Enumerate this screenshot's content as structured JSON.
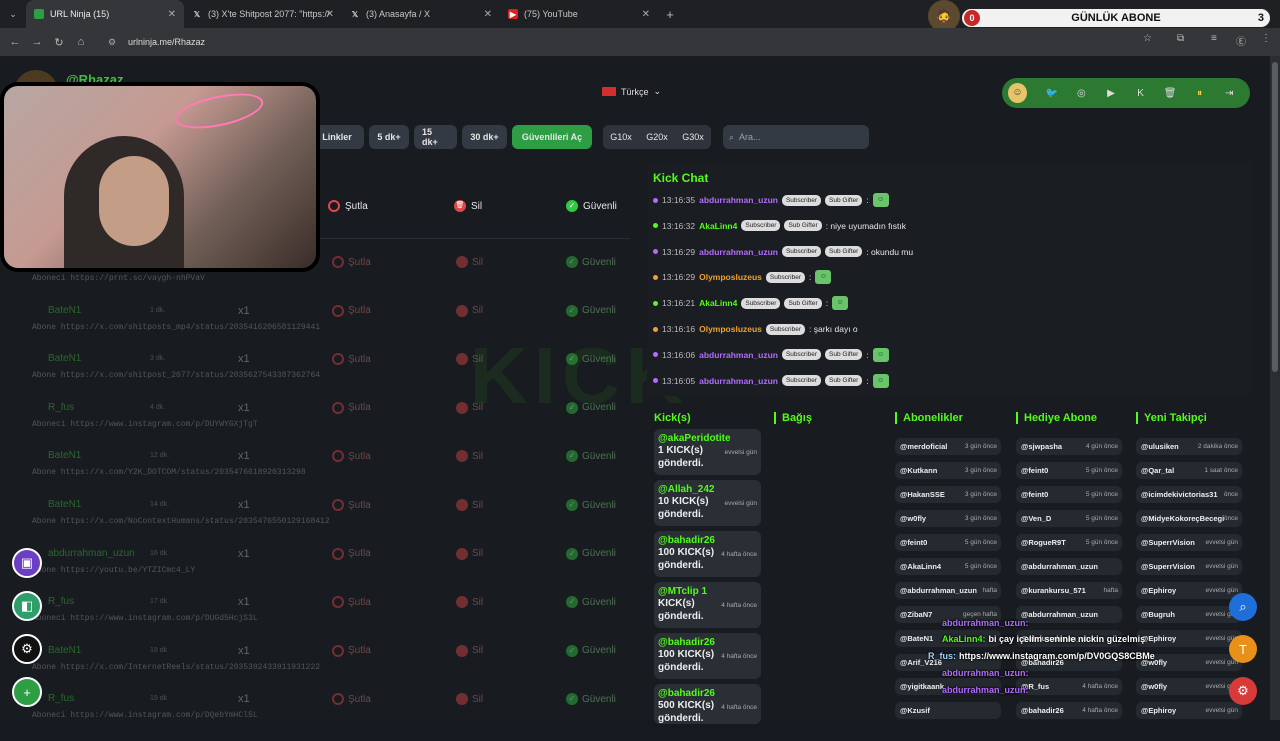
{
  "browser": {
    "tabs": [
      {
        "title": "URL Ninja (15)",
        "active": true,
        "icon": "urlninja-icon"
      },
      {
        "title": "(3) X'te Shitpost 2077: \"https://",
        "active": false,
        "icon": "x-icon"
      },
      {
        "title": "(3) Anasayfa / X",
        "active": false,
        "icon": "x-icon"
      },
      {
        "title": "(75) YouTube",
        "active": false,
        "icon": "youtube-icon"
      }
    ],
    "url": "urlninja.me/Rhazaz"
  },
  "sub_overlay": {
    "title": "GÜNLÜK ABONE",
    "left": "0",
    "right": "3"
  },
  "header": {
    "username": "@Rhazaz",
    "language": "Türkçe"
  },
  "filters": {
    "buttons": [
      "Linkler",
      "5 dk+",
      "15 dk+",
      "30 dk+",
      "Güvenlileri Aç",
      "G10x",
      "G20x",
      "G30x"
    ],
    "search_placeholder": "Ara..."
  },
  "actions_header": {
    "ban": "Şutla",
    "delete": "Sil",
    "safe": "Güvenli"
  },
  "links": [
    {
      "user": "",
      "time": "",
      "count": "",
      "link": "Aboneci https://prnt.sc/vaygh-nhPVaV"
    },
    {
      "user": "BateN1",
      "time": "1 dk.",
      "count": "x1",
      "link": "Abone https://x.com/shitposts_mp4/status/2035416206581129441"
    },
    {
      "user": "BateN1",
      "time": "3 dk.",
      "count": "x1",
      "link": "Abone https://x.com/shitpost_2077/status/2035627543387362764"
    },
    {
      "user": "R_fus",
      "time": "4 dk.",
      "count": "x1",
      "link": "Aboneci https://www.instagram.com/p/DUYWYGXjTgT"
    },
    {
      "user": "BateN1",
      "time": "12 dk.",
      "count": "x1",
      "link": "Abone https://x.com/Y2K_DOTCOM/status/2035476618920313298"
    },
    {
      "user": "BateN1",
      "time": "14 dk.",
      "count": "x1",
      "link": "Abone https://x.com/NoContextHumans/status/2035476550129168412"
    },
    {
      "user": "abdurrahman_uzun",
      "time": "16 dk.",
      "count": "x1",
      "link": "Abone https://youtu.be/YTZICmc4_LY"
    },
    {
      "user": "R_fus",
      "time": "17 dk.",
      "count": "x1",
      "link": "Aboneci https://www.instagram.com/p/DUGd5HcjS3L"
    },
    {
      "user": "BateN1",
      "time": "18 dk.",
      "count": "x1",
      "link": "Abone https://x.com/InternetReels/status/2035392433911931222"
    },
    {
      "user": "R_fus",
      "time": "19 dk.",
      "count": "x1",
      "link": "Aboneci https://www.instagram.com/p/DQebYmHCl5L"
    }
  ],
  "kick_chat": {
    "title": "Kick Chat",
    "messages": [
      {
        "time": "13:16:35",
        "user": "abdurrahman_uzun",
        "color": "#b36cff",
        "badges": [
          "Subscriber",
          "Sub Gifter"
        ],
        "text": ":"
      },
      {
        "time": "13:16:32",
        "user": "AkaLinn4",
        "color": "#53fc18",
        "badges": [
          "Subscriber",
          "Sub Gifter"
        ],
        "text": ": niye uyumadın fıstık"
      },
      {
        "time": "13:16:29",
        "user": "abdurrahman_uzun",
        "color": "#b36cff",
        "badges": [
          "Subscriber",
          "Sub Gifter"
        ],
        "text": ": okundu mu"
      },
      {
        "time": "13:16:29",
        "user": "Olymposluzeus",
        "color": "#f0a030",
        "badges": [
          "Subscriber"
        ],
        "text": ":"
      },
      {
        "time": "13:16:21",
        "user": "AkaLinn4",
        "color": "#53fc18",
        "badges": [
          "Subscriber",
          "Sub Gifter"
        ],
        "text": ":"
      },
      {
        "time": "13:16:16",
        "user": "Olymposluzeus",
        "color": "#f0a030",
        "badges": [
          "Subscriber"
        ],
        "text": ": şarkı dayı o"
      },
      {
        "time": "13:16:06",
        "user": "abdurrahman_uzun",
        "color": "#b36cff",
        "badges": [
          "Subscriber",
          "Sub Gifter"
        ],
        "text": ":"
      },
      {
        "time": "13:16:05",
        "user": "abdurrahman_uzun",
        "color": "#b36cff",
        "badges": [
          "Subscriber",
          "Sub Gifter"
        ],
        "text": ":"
      }
    ]
  },
  "columns": {
    "kicks": "Kick(s)",
    "donations": "Bağış",
    "subs": "Abonelikler",
    "gift_subs": "Hediye Abone",
    "followers": "Yeni Takipçi"
  },
  "kicks": [
    {
      "user": "@akaPeridotite",
      "text": "1 KICK(s) gönderdi.",
      "when": "evvelsi gün"
    },
    {
      "user": "@Allah_242",
      "text": "10 KICK(s) gönderdi.",
      "when": "evvelsi gün"
    },
    {
      "user": "@bahadir26",
      "text": "100 KICK(s) gönderdi.",
      "when": "4 hafta önce"
    },
    {
      "user": "@MTclip 1",
      "text": "KICK(s) gönderdi.",
      "when": "4 hafta önce"
    },
    {
      "user": "@bahadir26",
      "text": "100 KICK(s) gönderdi.",
      "when": "4 hafta önce"
    },
    {
      "user": "@bahadir26",
      "text": "500 KICK(s) gönderdi.",
      "when": "4 hafta önce"
    }
  ],
  "subs": [
    {
      "user": "@merdoficial",
      "when": "3 gün önce"
    },
    {
      "user": "@Kutkann",
      "when": "3 gün önce"
    },
    {
      "user": "@HakanSSE",
      "when": "3 gün önce"
    },
    {
      "user": "@w0fly",
      "when": "3 gün önce"
    },
    {
      "user": "@feint0",
      "when": "5 gün önce"
    },
    {
      "user": "@AkaLinn4",
      "when": "5 gün önce"
    },
    {
      "user": "@abdurrahman_uzun",
      "when": "hafta"
    },
    {
      "user": "@ZibaN7",
      "when": "geçen hafta"
    },
    {
      "user": "@BateN1",
      "when": ""
    },
    {
      "user": "@Arif_V216",
      "when": ""
    },
    {
      "user": "@yigitkaank",
      "when": ""
    },
    {
      "user": "@Kzusif",
      "when": ""
    }
  ],
  "gift_subs": [
    {
      "user": "@sjwpasha",
      "when": "4 gün önce"
    },
    {
      "user": "@feint0",
      "when": "5 gün önce"
    },
    {
      "user": "@feint0",
      "when": "5 gün önce"
    },
    {
      "user": "@Ven_D",
      "when": "5 gün önce"
    },
    {
      "user": "@RogueR9T",
      "when": "5 gün önce"
    },
    {
      "user": "@abdurrahman_uzun",
      "when": ""
    },
    {
      "user": "@kurankursu_571",
      "when": "hafta"
    },
    {
      "user": "@abdurrahman_uzun",
      "when": ""
    },
    {
      "user": "@abdurrahman_uzun",
      "when": ""
    },
    {
      "user": "@bahadir26",
      "when": ""
    },
    {
      "user": "@R_fus",
      "when": "4 hafta önce"
    },
    {
      "user": "@bahadir26",
      "when": "4 hafta önce"
    }
  ],
  "followers": [
    {
      "user": "@ulusiken",
      "when": "2 dakika önce"
    },
    {
      "user": "@Qar_tal",
      "when": "1 saat önce"
    },
    {
      "user": "@icimdekivictorias31",
      "when": "önce"
    },
    {
      "user": "@MidyeKokoreçBecegi",
      "when": "önce"
    },
    {
      "user": "@SuperrVision",
      "when": "evvelsi gün"
    },
    {
      "user": "@SuperrVision",
      "when": "evvelsi gün"
    },
    {
      "user": "@Ephiroy",
      "when": "evvelsi gün"
    },
    {
      "user": "@Bugruh",
      "when": "evvelsi gün"
    },
    {
      "user": "@Ephiroy",
      "when": "evvelsi gün"
    },
    {
      "user": "@w0fly",
      "when": "evvelsi gün"
    },
    {
      "user": "@w0fly",
      "when": "evvelsi gün"
    },
    {
      "user": "@Ephiroy",
      "when": "evvelsi gün"
    }
  ],
  "overlay_chat": [
    {
      "user": "abdurrahman_uzun:",
      "text": "",
      "color": "#b36cff"
    },
    {
      "user": "AkaLinn4:",
      "text": "bi çay içelim seninle nickin güzelmiş",
      "color": "#53fc18"
    },
    {
      "user": "R_fus:",
      "text": "https://www.instagram.com/p/DV0GQS8CBMe",
      "color": "#9bd6ff"
    },
    {
      "user": "abdurrahman_uzun:",
      "text": "",
      "color": "#b36cff"
    },
    {
      "user": "abdurrahman_uzun:",
      "text": "",
      "color": "#b36cff"
    }
  ],
  "colors": {
    "accent": "#53fc18",
    "bg": "#181c21",
    "danger": "#e04848",
    "safe": "#2ecc40"
  }
}
